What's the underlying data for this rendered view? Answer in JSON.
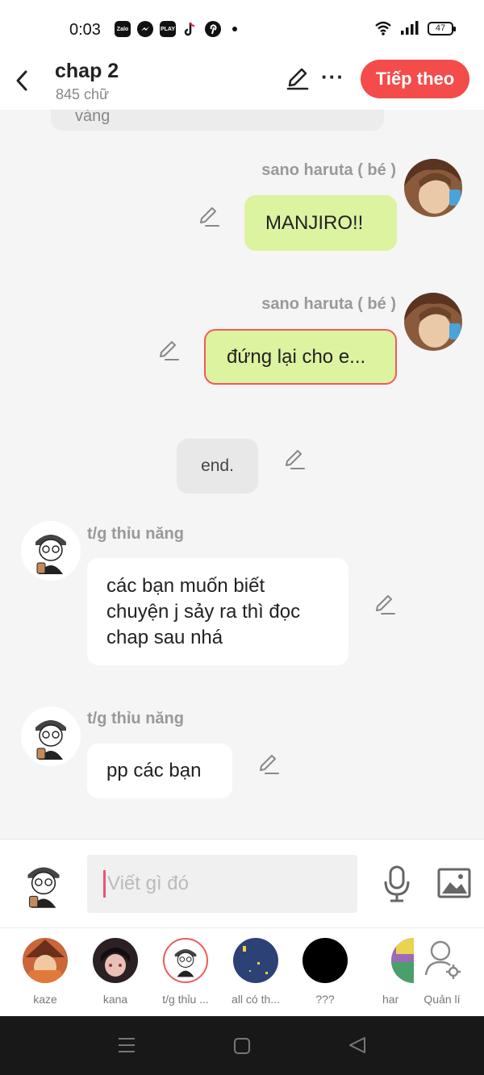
{
  "status_bar": {
    "time": "0:03",
    "apps": [
      "Zalo",
      "Messenger",
      "Play Together",
      "TikTok",
      "Pinterest"
    ],
    "battery": "47"
  },
  "header": {
    "title": "chap 2",
    "word_count": "845 chữ",
    "next_label": "Tiếp theo",
    "accent": "#f44b4b"
  },
  "chat": {
    "previous_bubble_text": "vàng",
    "messages": [
      {
        "speaker": "sano haruta ( bé )",
        "text": "MANJIRO!!",
        "color": "#dcf3a0"
      },
      {
        "speaker": "sano haruta ( bé )",
        "text": "đứng lại cho e...",
        "color": "#dcf3a0"
      },
      {
        "text": "end."
      },
      {
        "speaker": "t/g thỉu năng",
        "lines": [
          "các bạn muốn biết",
          "chuyện j sảy ra thì đọc",
          "chap sau nhá"
        ]
      },
      {
        "speaker": "t/g thỉu năng",
        "text": "pp các bạn"
      }
    ]
  },
  "composer": {
    "placeholder": "Viết gì đó"
  },
  "characters": [
    {
      "label": "kaze"
    },
    {
      "label": "kana"
    },
    {
      "label": "t/g thỉu ..."
    },
    {
      "label": "all có th..."
    },
    {
      "label": "???"
    },
    {
      "label": "har"
    },
    {
      "label": "Quản lí"
    }
  ]
}
